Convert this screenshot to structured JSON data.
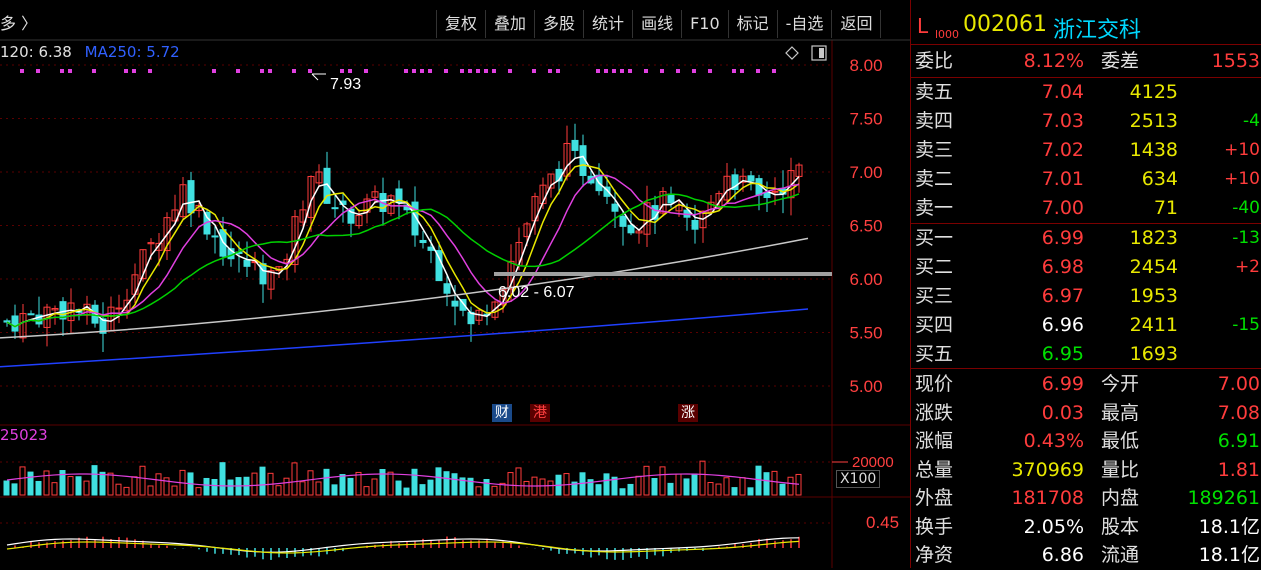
{
  "toolbar": {
    "left_text": "多 〉",
    "buttons": [
      "复权",
      "叠加",
      "多股",
      "统计",
      "画线",
      "F10",
      "标记",
      "-自选",
      "返回"
    ]
  },
  "ma_legend": [
    {
      "label": "120: 6.38",
      "color": "#e0e0e0"
    },
    {
      "label": "MA250: 5.72",
      "color": "#3060ff"
    }
  ],
  "price_axis": [
    "8.00",
    "7.50",
    "7.00",
    "6.50",
    "6.00",
    "5.50",
    "5.00"
  ],
  "annotations": {
    "high_label": "7.93",
    "range_label": "6.02 - 6.07"
  },
  "events": [
    {
      "text": "财",
      "color": "#ffffff",
      "bg": "#1a4a8a"
    },
    {
      "text": "港",
      "color": "#ff4040",
      "bg": "#5a0000"
    },
    {
      "text": "涨",
      "color": "#ffffff",
      "bg": "#5a0000"
    }
  ],
  "volume": {
    "label": "25023",
    "axis": "20000",
    "scale": "X100"
  },
  "macd": {
    "axis": "0.45"
  },
  "stock": {
    "market": "L",
    "sub": "l000",
    "code": "002061",
    "name": "浙江交科"
  },
  "weibi": {
    "label": "委比",
    "value": "8.12%",
    "label2": "委差",
    "value2": "1553"
  },
  "sell": [
    {
      "label": "卖五",
      "price": "7.04",
      "vol": "4125",
      "chg": ""
    },
    {
      "label": "卖四",
      "price": "7.03",
      "vol": "2513",
      "chg": "-4"
    },
    {
      "label": "卖三",
      "price": "7.02",
      "vol": "1438",
      "chg": "+10"
    },
    {
      "label": "卖二",
      "price": "7.01",
      "vol": "634",
      "chg": "+10"
    },
    {
      "label": "卖一",
      "price": "7.00",
      "vol": "71",
      "chg": "-40"
    }
  ],
  "buy": [
    {
      "label": "买一",
      "price": "6.99",
      "vol": "1823",
      "chg": "-13"
    },
    {
      "label": "买二",
      "price": "6.98",
      "vol": "2454",
      "chg": "+2"
    },
    {
      "label": "买三",
      "price": "6.97",
      "vol": "1953",
      "chg": ""
    },
    {
      "label": "买四",
      "price": "6.96",
      "vol": "2411",
      "chg": "-15"
    },
    {
      "label": "买五",
      "price": "6.95",
      "vol": "1693",
      "chg": ""
    }
  ],
  "quote": [
    {
      "l1": "现价",
      "v1": "6.99",
      "l2": "今开",
      "v2": "7.00"
    },
    {
      "l1": "涨跌",
      "v1": "0.03",
      "l2": "最高",
      "v2": "7.08"
    },
    {
      "l1": "涨幅",
      "v1": "0.43%",
      "l2": "最低",
      "v2": "6.91"
    },
    {
      "l1": "总量",
      "v1": "370969",
      "l2": "量比",
      "v2": "1.81"
    },
    {
      "l1": "外盘",
      "v1": "181708",
      "l2": "内盘",
      "v2": "189261"
    },
    {
      "l1": "换手",
      "v1": "2.05%",
      "l2": "股本",
      "v2": "18.1亿"
    },
    {
      "l1": "净资",
      "v1": "6.86",
      "l2": "流通",
      "v2": "18.1亿"
    }
  ],
  "colors": {
    "up": "#ff3c3c",
    "down": "#40e0e0",
    "grid": "#5a0000",
    "accent": "#00d8ff"
  }
}
